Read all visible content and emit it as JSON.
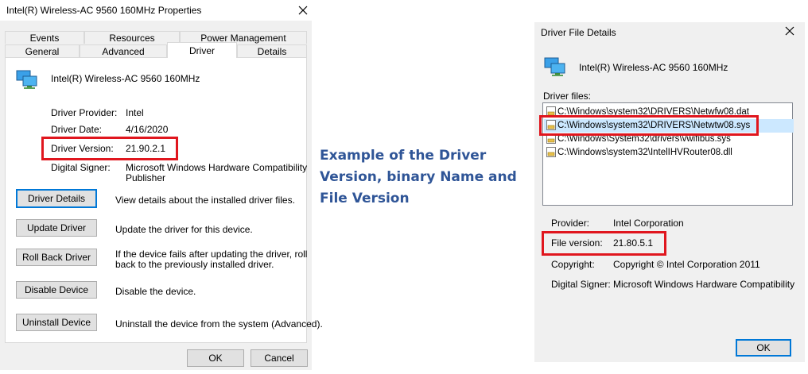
{
  "props": {
    "title": "Intel(R) Wireless-AC 9560 160MHz Properties",
    "tabs_top": [
      "Events",
      "Resources",
      "Power Management"
    ],
    "tabs_bottom": [
      "General",
      "Advanced",
      "Driver",
      "Details"
    ],
    "device_name": "Intel(R) Wireless-AC 9560 160MHz",
    "provider_label": "Driver Provider:",
    "provider_value": "Intel",
    "date_label": "Driver Date:",
    "date_value": "4/16/2020",
    "version_label": "Driver Version:",
    "version_value": "21.90.2.1",
    "signer_label": "Digital Signer:",
    "signer_value_1": "Microsoft Windows Hardware Compatibility",
    "signer_value_2": "Publisher",
    "buttons": [
      {
        "label": "Driver Details",
        "desc_1": "View details about the installed driver files.",
        "desc_2": ""
      },
      {
        "label": "Update Driver",
        "desc_1": "Update the driver for this device.",
        "desc_2": ""
      },
      {
        "label": "Roll Back Driver",
        "desc_1": "If the device fails after updating the driver, roll",
        "desc_2": "back to the previously installed driver."
      },
      {
        "label": "Disable Device",
        "desc_1": "Disable the device.",
        "desc_2": ""
      },
      {
        "label": "Uninstall Device",
        "desc_1": "Uninstall the device from the system (Advanced).",
        "desc_2": ""
      }
    ],
    "ok": "OK",
    "cancel": "Cancel"
  },
  "caption": {
    "line1": "Example of the Driver",
    "line2": "Version, binary Name and",
    "line3": "File Version",
    "color": "#2f5597"
  },
  "details": {
    "title": "Driver File Details",
    "device_name": "Intel(R) Wireless-AC 9560 160MHz",
    "files_label": "Driver files:",
    "files": [
      "C:\\Windows\\system32\\DRIVERS\\Netwfw08.dat",
      "C:\\Windows\\system32\\DRIVERS\\Netwtw08.sys",
      "C:\\Windows\\System32\\drivers\\vwifibus.sys",
      "C:\\Windows\\system32\\IntelIHVRouter08.dll"
    ],
    "provider_label": "Provider:",
    "provider_value": "Intel Corporation",
    "fileversion_label": "File version:",
    "fileversion_value": "21.80.5.1",
    "copyright_label": "Copyright:",
    "copyright_value": "Copyright © Intel Corporation 2011",
    "signer_label": "Digital Signer:",
    "signer_value": "Microsoft Windows Hardware Compatibility",
    "ok": "OK"
  },
  "colors": {
    "highlight": "#e0161e",
    "selection": "#cce8ff",
    "dialog_bg": "#f0f0f0"
  },
  "icons": [
    "network-adapter-icon",
    "close-icon",
    "driver-file-icon"
  ]
}
